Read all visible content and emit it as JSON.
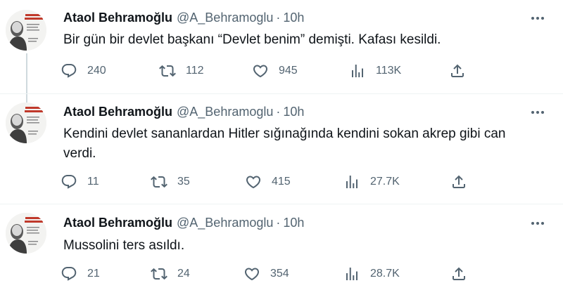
{
  "tweets": [
    {
      "name": "Ataol Behramoğlu",
      "handle": "@A_Behramoglu",
      "dot": "·",
      "time": "10h",
      "text": "Bir gün bir devlet başkanı “Devlet benim” demişti. Kafası kesildi.",
      "replies": "240",
      "retweets": "112",
      "likes": "945",
      "views": "113K"
    },
    {
      "name": "Ataol Behramoğlu",
      "handle": "@A_Behramoglu",
      "dot": "·",
      "time": "10h",
      "text": "Kendini devlet sananlardan Hitler sığınağında kendini sokan akrep gibi can verdi.",
      "replies": "11",
      "retweets": "35",
      "likes": "415",
      "views": "27.7K"
    },
    {
      "name": "Ataol Behramoğlu",
      "handle": "@A_Behramoglu",
      "dot": "·",
      "time": "10h",
      "text": "Mussolini ters asıldı.",
      "replies": "21",
      "retweets": "24",
      "likes": "354",
      "views": "28.7K"
    }
  ],
  "icons": {
    "reply": "reply-icon",
    "retweet": "retweet-icon",
    "like": "heart-icon",
    "views": "views-icon",
    "share": "share-icon",
    "more": "more-icon"
  },
  "colors": {
    "text": "#0f1419",
    "secondary": "#536471",
    "divider": "#eff3f4"
  }
}
